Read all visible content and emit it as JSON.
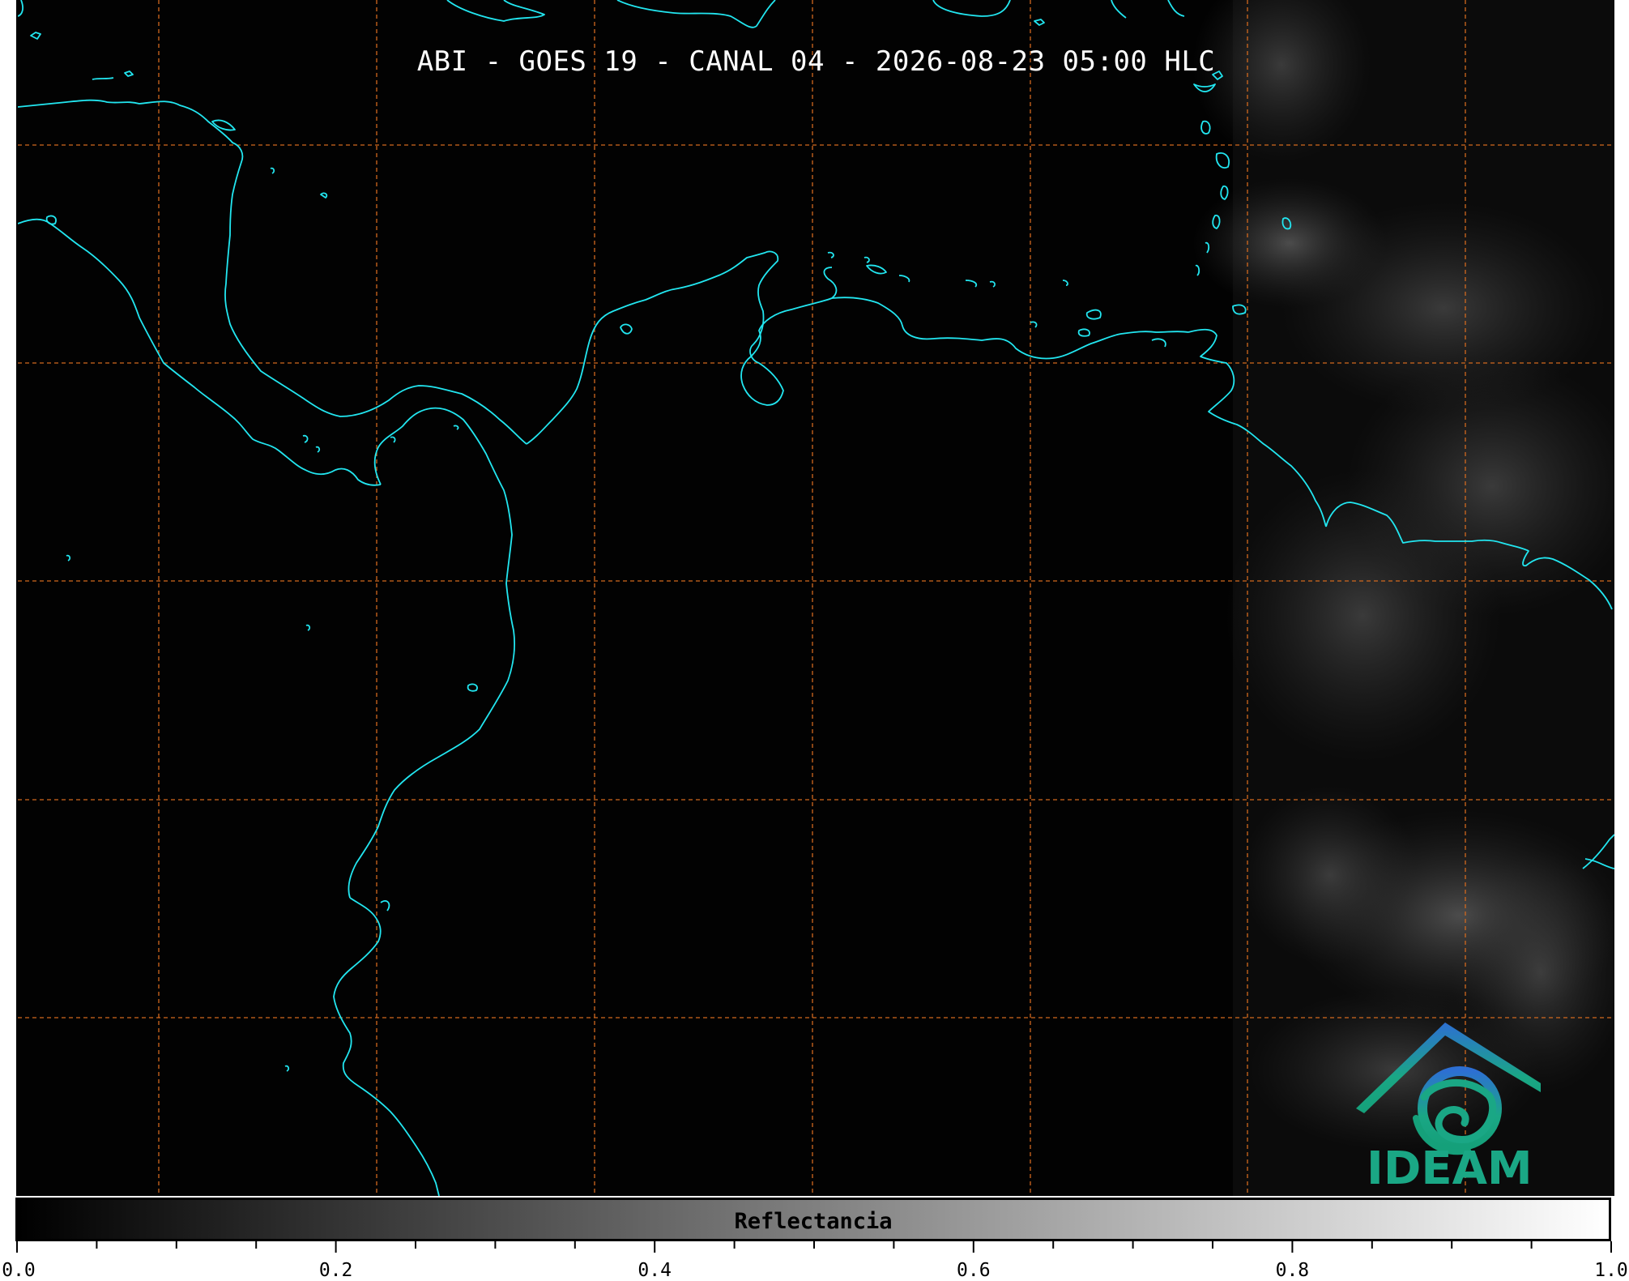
{
  "title": "ABI - GOES 19 - CANAL 04 - 2026-08-23 05:00 HLC",
  "logo": {
    "text": "IDEAM",
    "color": "#1aa785"
  },
  "colors": {
    "coastline": "#22e6f0",
    "gridlines": "#d2691e",
    "background": "#020202"
  },
  "colorbar": {
    "label": "Reflectancia",
    "range": [
      0.0,
      1.0
    ],
    "gradient": [
      "#000000",
      "#ffffff"
    ],
    "major_ticks": [
      "0.0",
      "0.2",
      "0.4",
      "0.6",
      "0.8",
      "1.0"
    ],
    "minor_tick_step": 0.05
  }
}
